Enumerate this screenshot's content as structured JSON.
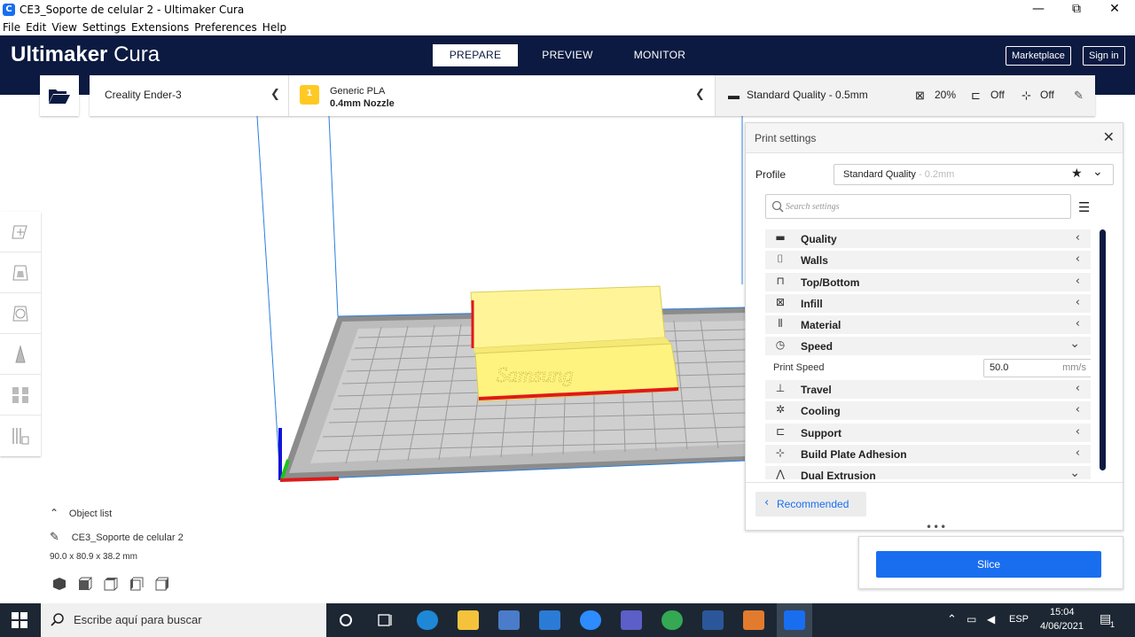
{
  "window": {
    "title": "CE3_Soporte de celular 2 - Ultimaker Cura",
    "minimize": "—",
    "restore": "⧉",
    "close": "✕"
  },
  "menu": [
    "File",
    "Edit",
    "View",
    "Settings",
    "Extensions",
    "Preferences",
    "Help"
  ],
  "header": {
    "logo_bold": "Ultimaker",
    "logo_light": "Cura",
    "stages": [
      "PREPARE",
      "PREVIEW",
      "MONITOR"
    ],
    "marketplace": "Marketplace",
    "sign_in": "Sign in"
  },
  "toolbar": {
    "printer": "Creality Ender-3",
    "material_badge": "1",
    "material_name": "Generic PLA",
    "nozzle": "0.4mm Nozzle",
    "quality": "Standard Quality - 0.5mm",
    "infill": "20%",
    "support": "Off",
    "adhesion": "Off"
  },
  "object_list": {
    "title": "Object list",
    "object_name": "CE3_Soporte de celular 2",
    "dimensions": "90.0 x 80.9 x 38.2 mm"
  },
  "print_settings": {
    "title": "Print settings",
    "profile_label": "Profile",
    "profile_value": "Standard Quality",
    "profile_sub": " - 0.2mm",
    "search_placeholder": "Search settings",
    "categories": [
      {
        "label": "Quality",
        "icon": "quality-icon",
        "glyph": "▬",
        "expanded": false
      },
      {
        "label": "Walls",
        "icon": "walls-icon",
        "glyph": "⌷",
        "expanded": false
      },
      {
        "label": "Top/Bottom",
        "icon": "top-bottom-icon",
        "glyph": "⊓",
        "expanded": false
      },
      {
        "label": "Infill",
        "icon": "infill-icon",
        "glyph": "⊠",
        "expanded": false
      },
      {
        "label": "Material",
        "icon": "material-icon",
        "glyph": "⦀",
        "expanded": false
      },
      {
        "label": "Speed",
        "icon": "speed-icon",
        "glyph": "◷",
        "expanded": true
      }
    ],
    "speed_setting": {
      "label": "Print Speed",
      "value": "50.0",
      "unit": "mm/s"
    },
    "categories_after": [
      {
        "label": "Travel",
        "icon": "travel-icon",
        "glyph": "⊥"
      },
      {
        "label": "Cooling",
        "icon": "cooling-icon",
        "glyph": "✲"
      },
      {
        "label": "Support",
        "icon": "support-icon",
        "glyph": "⊏"
      },
      {
        "label": "Build Plate Adhesion",
        "icon": "adhesion-icon",
        "glyph": "⊹"
      },
      {
        "label": "Dual Extrusion",
        "icon": "dual-extrusion-icon",
        "glyph": "⋀"
      }
    ],
    "recommended": "Recommended"
  },
  "slice": {
    "label": "Slice"
  },
  "taskbar": {
    "search_placeholder": "Escribe aquí para buscar",
    "language": "ESP",
    "time": "15:04",
    "date": "4/06/2021",
    "notification_count": "1"
  }
}
